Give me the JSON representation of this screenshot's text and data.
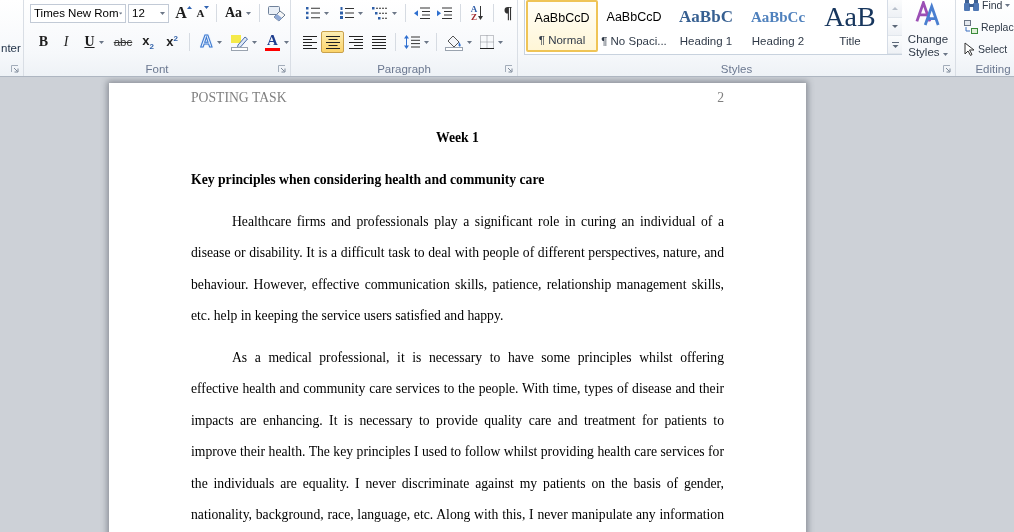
{
  "ribbon": {
    "clipped_group": {
      "label_tail": "nter"
    },
    "font_group": {
      "label": "Font",
      "font_name": "Times New Rom",
      "font_size": "12",
      "grow_font": "A",
      "shrink_font": "A",
      "change_case": "Aa",
      "bold": "B",
      "italic": "I",
      "underline": "U",
      "strikethrough": "abc",
      "subscript": "x$_{2}$",
      "superscript": "x$^{2}$",
      "text_effects": "A",
      "font_color": "A"
    },
    "paragraph_group": {
      "label": "Paragraph",
      "sort": [
        "A",
        "Z"
      ],
      "show_marks": "¶",
      "alignment": [
        {
          "kind": "left",
          "selected": false
        },
        {
          "kind": "center",
          "selected": true
        },
        {
          "kind": "right",
          "selected": false
        },
        {
          "kind": "justify",
          "selected": false
        }
      ]
    },
    "styles_group": {
      "label": "Styles",
      "styles": [
        {
          "kind": "normal",
          "sample": "AaBbCcD",
          "name": "¶ Normal",
          "selected": true
        },
        {
          "kind": "no_spacing",
          "sample": "AaBbCcD",
          "name": "¶ No Spaci...",
          "selected": false
        },
        {
          "kind": "heading1",
          "sample": "AaBbC",
          "name": "Heading 1",
          "selected": false
        },
        {
          "kind": "heading2",
          "sample": "AaBbCc",
          "name": "Heading 2",
          "selected": false
        },
        {
          "kind": "title",
          "sample": "AaB",
          "name": "Title",
          "selected": false
        }
      ],
      "change_styles": "Change Styles"
    },
    "editing_group": {
      "label": "Editing",
      "find": "Find",
      "replace": "Replac",
      "select": "Select"
    }
  },
  "document": {
    "header": {
      "running_head": "POSTING TASK",
      "page_number": "2"
    },
    "title": "Week 1",
    "heading": "Key principles when considering health and community care",
    "paragraphs": [
      {
        "text": "Healthcare firms and professionals play a significant role in curing an individual of a disease or disability. It is a difficult task to deal with people of different perspectives, nature, and behaviour. However, effective communication skills, patience, relationship management skills, etc. help in keeping the service users satisfied and happy.",
        "continues": false
      },
      {
        "text": "As a medical professional, it is necessary to have some principles whilst offering effective health and community care services to the people. With time, types of disease and their impacts are enhancing. It is necessary to provide quality care and treatment for patients to improve their health. The key principles I used to follow whilst providing health care services for the individuals are equality. I never discriminate against my patients on the basis of gender, nationality, background, race, language, etc. Along with this, I never manipulate any information",
        "continues": true
      }
    ]
  }
}
